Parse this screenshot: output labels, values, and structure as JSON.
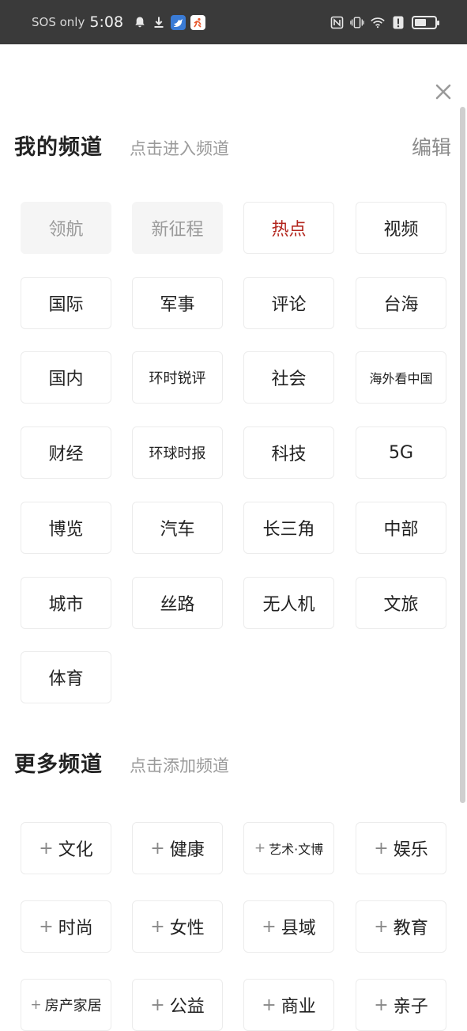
{
  "status_bar": {
    "carrier": "SOS only",
    "time": "5:08",
    "battery_level": 0.6
  },
  "my_channels": {
    "title": "我的频道",
    "hint": "点击进入频道",
    "edit_label": "编辑",
    "items": [
      {
        "label": "领航",
        "state": "fixed"
      },
      {
        "label": "新征程",
        "state": "fixed"
      },
      {
        "label": "热点",
        "state": "active"
      },
      {
        "label": "视频",
        "state": "normal"
      },
      {
        "label": "国际",
        "state": "normal"
      },
      {
        "label": "军事",
        "state": "normal"
      },
      {
        "label": "评论",
        "state": "normal"
      },
      {
        "label": "台海",
        "state": "normal"
      },
      {
        "label": "国内",
        "state": "normal"
      },
      {
        "label": "环时锐评",
        "state": "normal"
      },
      {
        "label": "社会",
        "state": "normal"
      },
      {
        "label": "海外看中国",
        "state": "normal"
      },
      {
        "label": "财经",
        "state": "normal"
      },
      {
        "label": "环球时报",
        "state": "normal"
      },
      {
        "label": "科技",
        "state": "normal"
      },
      {
        "label": "5G",
        "state": "normal"
      },
      {
        "label": "博览",
        "state": "normal"
      },
      {
        "label": "汽车",
        "state": "normal"
      },
      {
        "label": "长三角",
        "state": "normal"
      },
      {
        "label": "中部",
        "state": "normal"
      },
      {
        "label": "城市",
        "state": "normal"
      },
      {
        "label": "丝路",
        "state": "normal"
      },
      {
        "label": "无人机",
        "state": "normal"
      },
      {
        "label": "文旅",
        "state": "normal"
      },
      {
        "label": "体育",
        "state": "normal"
      }
    ]
  },
  "more_channels": {
    "title": "更多频道",
    "hint": "点击添加频道",
    "plus_symbol": "+",
    "items": [
      {
        "label": "文化"
      },
      {
        "label": "健康"
      },
      {
        "label": "艺术·文博"
      },
      {
        "label": "娱乐"
      },
      {
        "label": "时尚"
      },
      {
        "label": "女性"
      },
      {
        "label": "县域"
      },
      {
        "label": "教育"
      },
      {
        "label": "房产家居"
      },
      {
        "label": "公益"
      },
      {
        "label": "商业"
      },
      {
        "label": "亲子"
      }
    ]
  },
  "colors": {
    "active": "#b3261e",
    "fixed_bg": "#f5f5f5",
    "status_bar_bg": "#3a3a3a"
  }
}
